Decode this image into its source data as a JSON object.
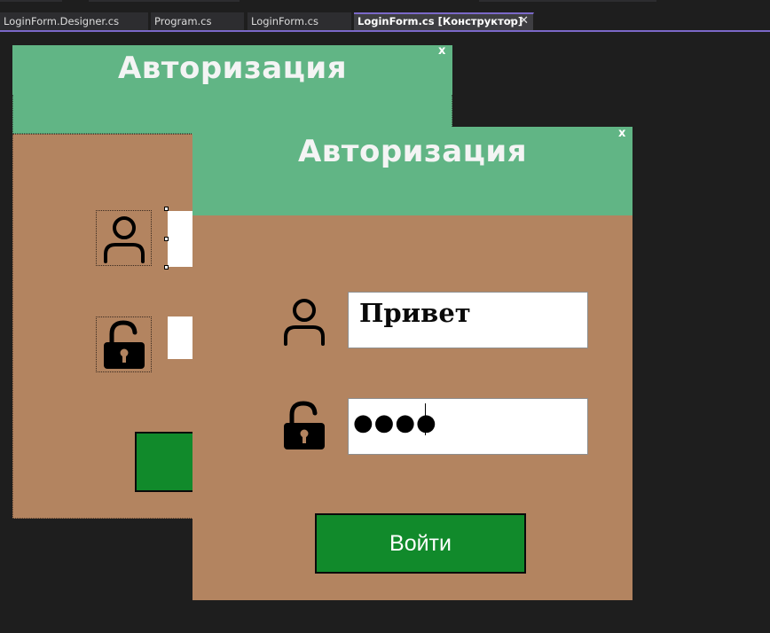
{
  "ide": {
    "tabs": [
      {
        "label": "LoginForm.Designer.cs",
        "active": false
      },
      {
        "label": "Program.cs",
        "active": false
      },
      {
        "label": "LoginForm.cs",
        "active": false
      },
      {
        "label": "LoginForm.cs [Конструктор]",
        "active": true
      }
    ],
    "pin_glyph": "⊸",
    "close_glyph": "✕",
    "accent": "#7b68c8"
  },
  "designer_form": {
    "title": "Авторизация",
    "close_label": "x",
    "header_color": "#61b585",
    "body_color": "#b38460",
    "icons": [
      "user-icon",
      "unlock-icon"
    ]
  },
  "login_form": {
    "title": "Авторизация",
    "close_label": "x",
    "username": {
      "value": "Привет",
      "icon": "user-icon"
    },
    "password": {
      "masked_value": "●●●●",
      "length": 4,
      "icon": "unlock-icon"
    },
    "login_button": {
      "label": "Войти",
      "color": "#118a2b"
    },
    "header_color": "#61b585",
    "body_color": "#b38460"
  }
}
